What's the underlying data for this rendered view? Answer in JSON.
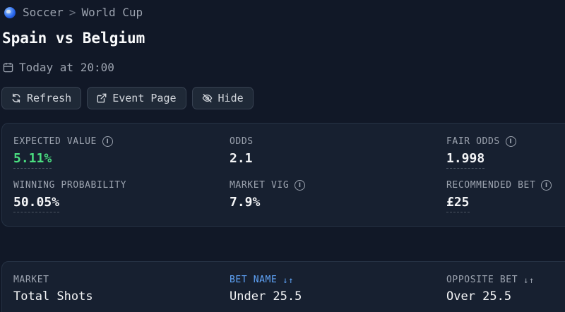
{
  "breadcrumb": {
    "sport": "Soccer",
    "separator": ">",
    "league": "World Cup",
    "sport_icon": "globe-icon"
  },
  "event": {
    "title": "Spain vs Belgium",
    "time": "Today at 20:00"
  },
  "actions": {
    "refresh": "Refresh",
    "event_page": "Event Page",
    "hide": "Hide"
  },
  "stats": {
    "expected_value": {
      "label": "EXPECTED VALUE",
      "value": "5.11%"
    },
    "odds": {
      "label": "ODDS",
      "value": "2.1"
    },
    "fair_odds": {
      "label": "FAIR ODDS",
      "value": "1.998"
    },
    "winning_probability": {
      "label": "WINNING PROBABILITY",
      "value": "50.05%"
    },
    "market_vig": {
      "label": "MARKET VIG",
      "value": "7.9%"
    },
    "recommended_bet": {
      "label": "RECOMMENDED BET",
      "value": "£25"
    }
  },
  "market": {
    "market": {
      "label": "MARKET",
      "value": "Total Shots"
    },
    "bet_name": {
      "label": "BET NAME",
      "value": "Under 25.5"
    },
    "opposite_bet": {
      "label": "OPPOSITE BET",
      "value": "Over 25.5"
    }
  },
  "colors": {
    "background": "#111827",
    "card": "#172030",
    "positive": "#4ade80",
    "accent": "#60a5fa"
  }
}
